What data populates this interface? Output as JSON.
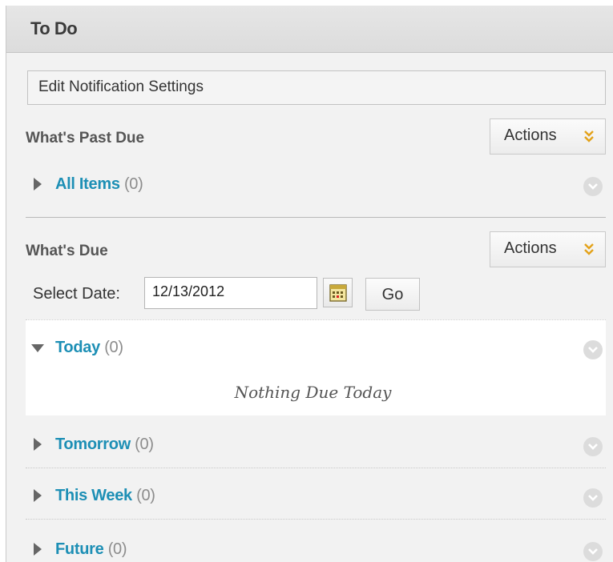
{
  "module": {
    "title": "To Do",
    "edit_notifications_label": "Edit Notification Settings"
  },
  "past_due": {
    "title": "What's Past Due",
    "actions_label": "Actions",
    "items": [
      {
        "label": "All Items",
        "count": "(0)",
        "expanded": false
      }
    ]
  },
  "due": {
    "title": "What's Due",
    "actions_label": "Actions",
    "select_date_label": "Select Date:",
    "date_value": "12/13/2012",
    "go_label": "Go",
    "groups": [
      {
        "label": "Today",
        "count": "(0)",
        "expanded": true,
        "empty_message": "Nothing Due Today"
      },
      {
        "label": "Tomorrow",
        "count": "(0)",
        "expanded": false
      },
      {
        "label": "This Week",
        "count": "(0)",
        "expanded": false
      },
      {
        "label": "Future",
        "count": "(0)",
        "expanded": false
      }
    ]
  },
  "colors": {
    "link": "#1d8fb5",
    "count": "#8c8c8c",
    "chevron_accent": "#e3a21a",
    "panel_bg": "#f2f2f2"
  },
  "icons": {
    "collapsed": "triangle-right-icon",
    "expanded": "triangle-down-icon",
    "options": "circle-chevron-down-icon",
    "calendar": "calendar-icon",
    "actions_menu": "double-chevron-down-icon"
  }
}
